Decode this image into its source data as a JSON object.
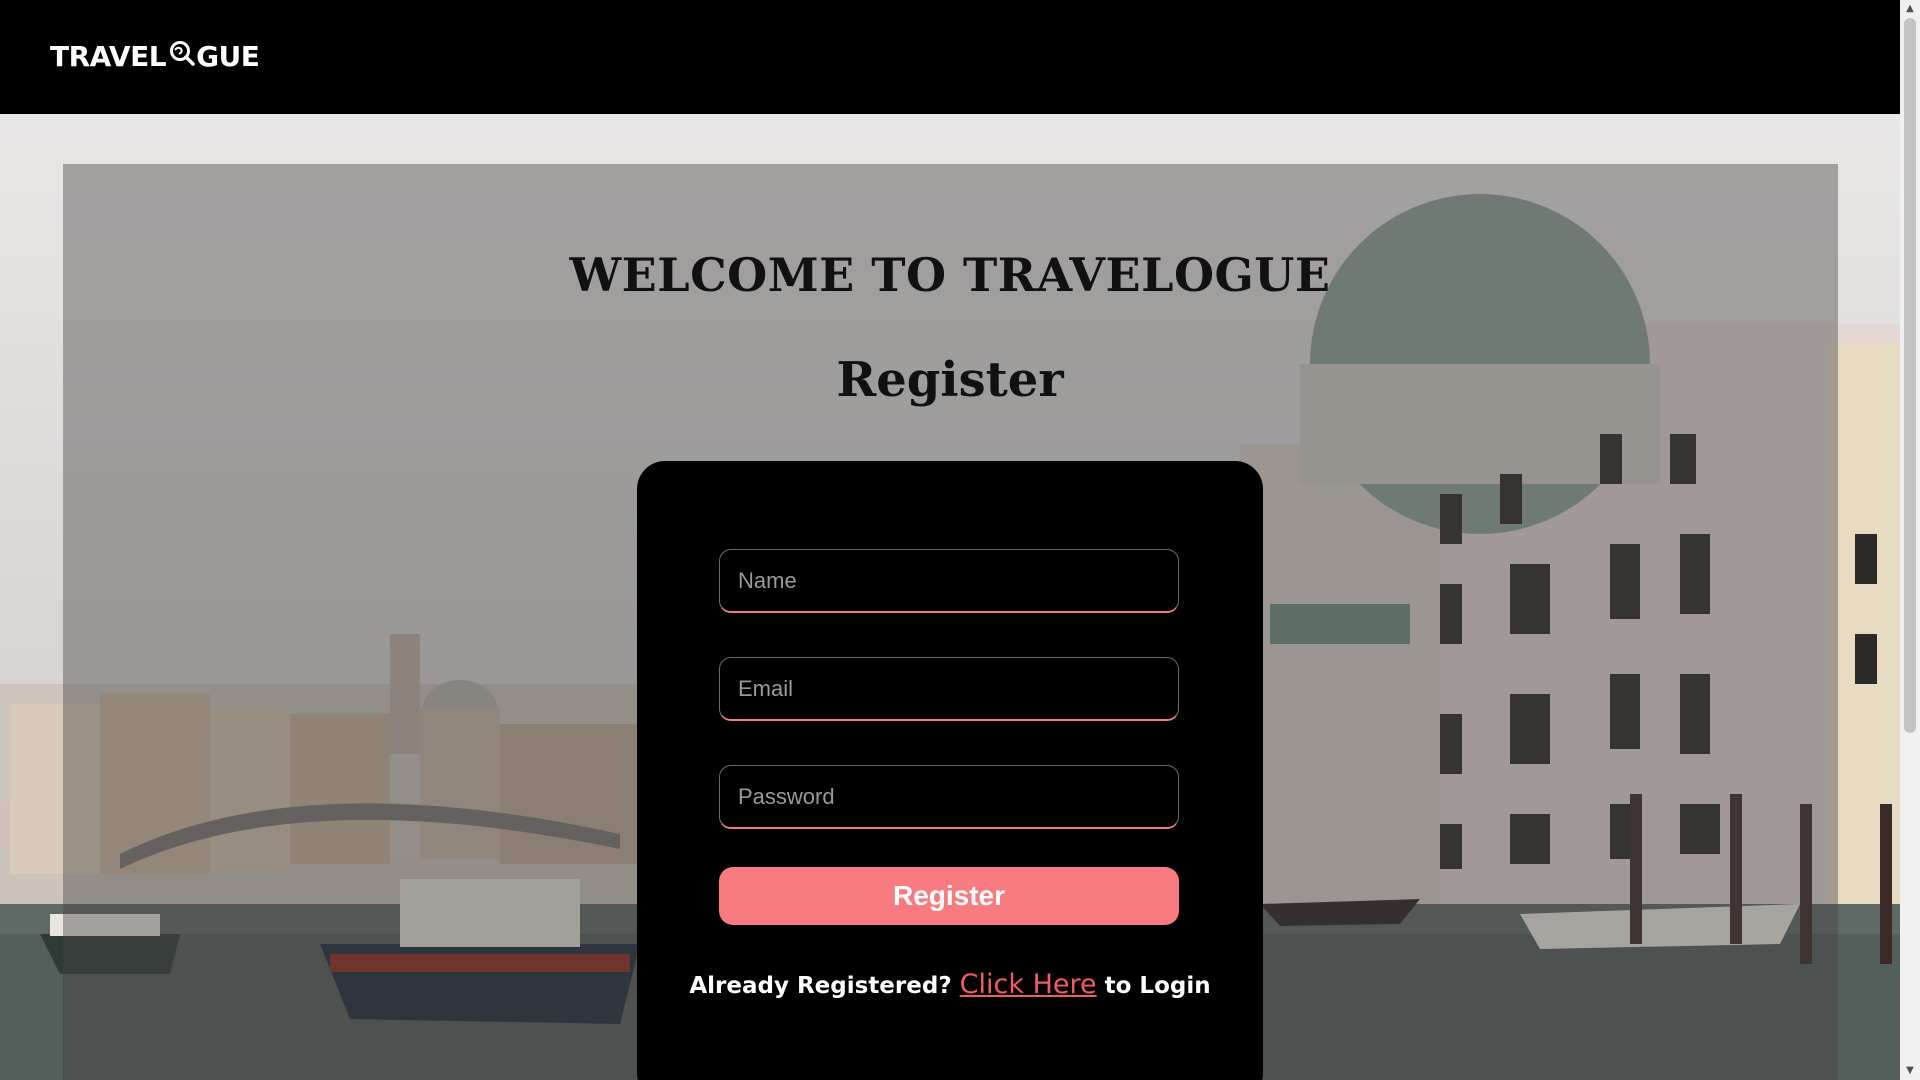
{
  "navbar": {
    "logo_left": "TRAVEL",
    "logo_right": "GUE",
    "logo_icon": "globe-magnifier-icon"
  },
  "main": {
    "welcome": "WELCOME TO TRAVELOGUE",
    "heading": "Register"
  },
  "form": {
    "name_placeholder": "Name",
    "email_placeholder": "Email",
    "password_placeholder": "Password",
    "submit_label": "Register",
    "login_prefix": "Already Registered? ",
    "login_link": "Click Here",
    "login_suffix": " to Login"
  },
  "colors": {
    "accent": "#f77b7f",
    "link": "#f25b62",
    "navbar": "#000000",
    "card": "#000000"
  },
  "background_image": "venice-grand-canal-photo"
}
